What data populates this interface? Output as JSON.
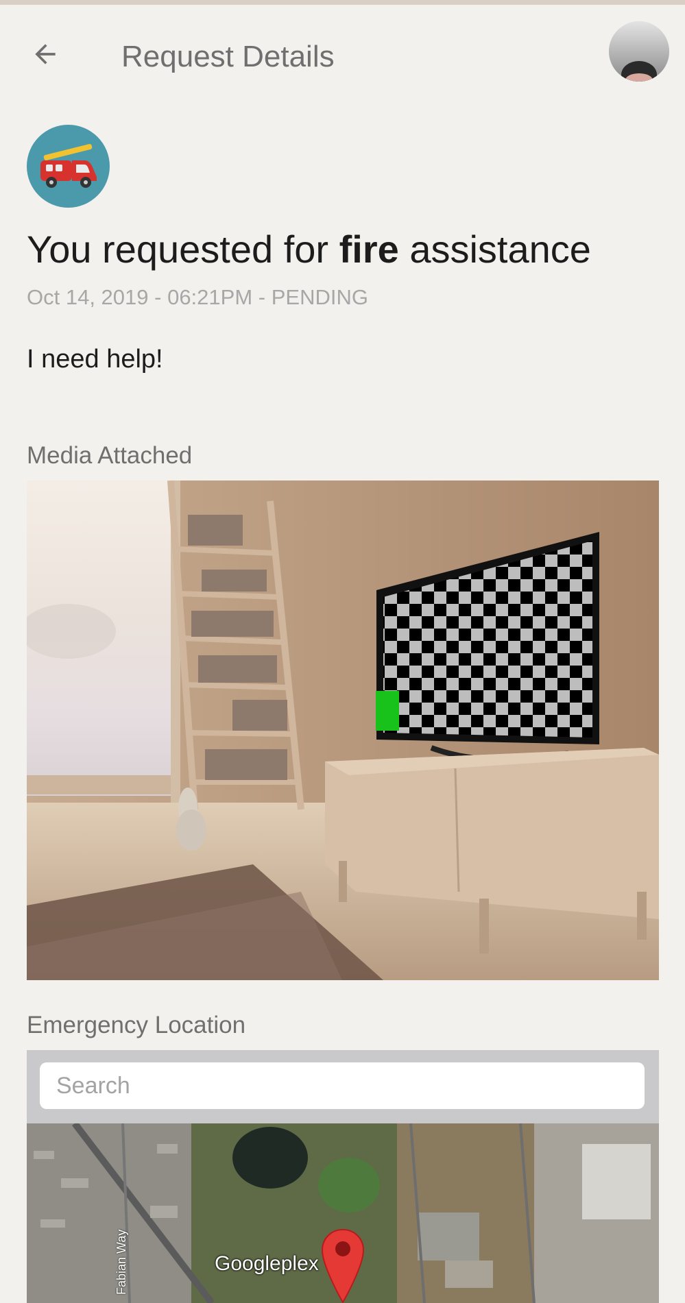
{
  "header": {
    "title": "Request Details",
    "back_icon": "arrow-back-icon",
    "avatar_icon": "user-avatar"
  },
  "request": {
    "type_icon": "fire-truck-icon",
    "headline_prefix": "You requested for ",
    "headline_type": "fire",
    "headline_suffix": " assistance",
    "date": "Oct 14, 2019",
    "time": "06:21PM",
    "status": "PENDING",
    "separator": " - ",
    "message": "I need help!"
  },
  "media": {
    "label": "Media Attached"
  },
  "location": {
    "label": "Emergency Location",
    "search_placeholder": "Search",
    "place_label": "Googleplex",
    "street_label": "Fabian Way",
    "pin_icon": "map-pin-icon"
  },
  "colors": {
    "background": "#f3f1ee",
    "icon_circle": "#4a9aab",
    "pin": "#e53935"
  }
}
